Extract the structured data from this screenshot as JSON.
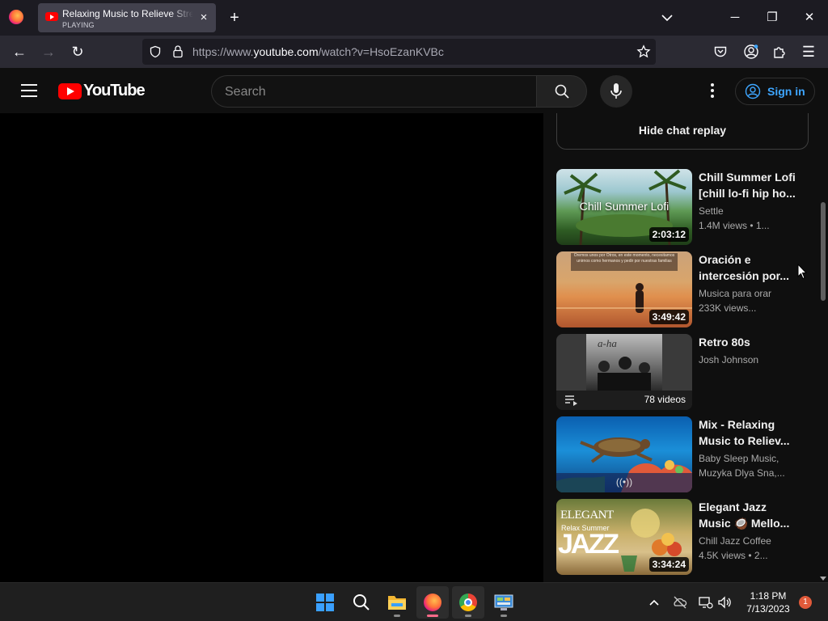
{
  "browser": {
    "tab": {
      "title": "Relaxing Music to Relieve Stress",
      "status": "PLAYING",
      "close_glyph": "×"
    },
    "newtab_glyph": "+",
    "url": {
      "prefix": "https://www.",
      "domain": "youtube.com",
      "path": "/watch?v=HsoEzanKVBc"
    },
    "window": {
      "minimize": "─",
      "restore": "❐",
      "close": "✕"
    },
    "nav": {
      "back": "←",
      "forward": "→",
      "reload": "↻",
      "menu": "☰"
    }
  },
  "youtube": {
    "logo_text": "YouTube",
    "search_placeholder": "Search",
    "sign_in_label": "Sign in",
    "hide_chat_label": "Hide chat replay",
    "recommendations": [
      {
        "title_line1": "Chill Summer Lofi",
        "title_line2": "[chill lo-fi hip ho...",
        "channel": "Settle",
        "meta": "1.4M views • 1...",
        "duration": "2:03:12",
        "thumb_text": "Chill Summer Lofi"
      },
      {
        "title_line1": "Oración e",
        "title_line2": "intercesión por...",
        "channel": "Musica para orar",
        "meta": "233K views...",
        "duration": "3:49:42",
        "thumb_text": "Oremos unos por Otros, en este momento, necesitamos unirnos como hermanos y pedir por nuestras familias"
      },
      {
        "title_line1": "Retro 80s",
        "title_line2": "",
        "channel": "Josh Johnson",
        "meta": "",
        "duration": "78 videos",
        "thumb_text": "a-ha"
      },
      {
        "title_line1": "Mix - Relaxing",
        "title_line2": "Music to Reliev...",
        "channel": "Baby Sleep Music,",
        "meta": "Muzyka Dlya Sna,...",
        "duration": "",
        "thumb_text": "((•))"
      },
      {
        "title_line1": "Elegant Jazz",
        "title_line2": "Music 🥥 Mello...",
        "channel": "Chill Jazz Coffee",
        "meta": "4.5K views • 2...",
        "duration": "3:34:24",
        "thumb_text": "ELEGANT",
        "thumb_text2": "Relax Summer",
        "thumb_text3": "JAZZ"
      }
    ]
  },
  "taskbar": {
    "time": "1:18 PM",
    "date": "7/13/2023",
    "notification_count": "1",
    "tray_chevron": "^",
    "icons": [
      "windows-start-icon",
      "search-icon",
      "file-explorer-icon",
      "firefox-icon",
      "chrome-icon",
      "control-panel-icon"
    ]
  },
  "colors": {
    "yt_red": "#ff0000",
    "link_blue": "#3ea6ff",
    "bg": "#0f0f0f"
  }
}
